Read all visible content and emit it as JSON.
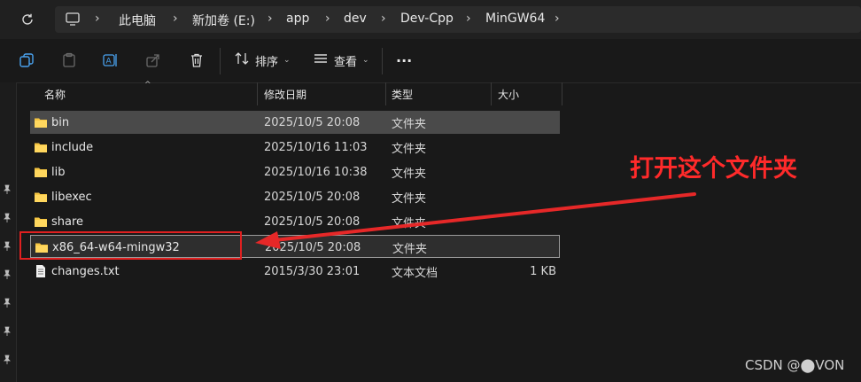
{
  "breadcrumb": [
    "此电脑",
    "新加卷 (E:)",
    "app",
    "dev",
    "Dev-Cpp",
    "MinGW64"
  ],
  "toolbar": {
    "sort_label": "排序",
    "view_label": "查看",
    "more_label": "···"
  },
  "columns": {
    "name": "名称",
    "modified": "修改日期",
    "type": "类型",
    "size": "大小"
  },
  "files": [
    {
      "name": "bin",
      "modified": "2025/10/5 20:08",
      "type": "文件夹",
      "size": "",
      "icon": "folder-icon"
    },
    {
      "name": "include",
      "modified": "2025/10/16 11:03",
      "type": "文件夹",
      "size": "",
      "icon": "folder-icon"
    },
    {
      "name": "lib",
      "modified": "2025/10/16 10:38",
      "type": "文件夹",
      "size": "",
      "icon": "folder-icon"
    },
    {
      "name": "libexec",
      "modified": "2025/10/5 20:08",
      "type": "文件夹",
      "size": "",
      "icon": "folder-icon"
    },
    {
      "name": "share",
      "modified": "2025/10/5 20:08",
      "type": "文件夹",
      "size": "",
      "icon": "folder-icon"
    },
    {
      "name": "x86_64-w64-mingw32",
      "modified": "2025/10/5 20:08",
      "type": "文件夹",
      "size": "",
      "icon": "folder-icon"
    },
    {
      "name": "changes.txt",
      "modified": "2015/3/30 23:01",
      "type": "文本文档",
      "size": "1 KB",
      "icon": "text-file-icon"
    }
  ],
  "annotation": {
    "text": "打开这个文件夹",
    "color": "#ff2a2a"
  },
  "watermark": "CSDN @⬤VON",
  "colors": {
    "background": "#191919",
    "folder": "#f5c542",
    "selection": "#4a4a4a"
  }
}
